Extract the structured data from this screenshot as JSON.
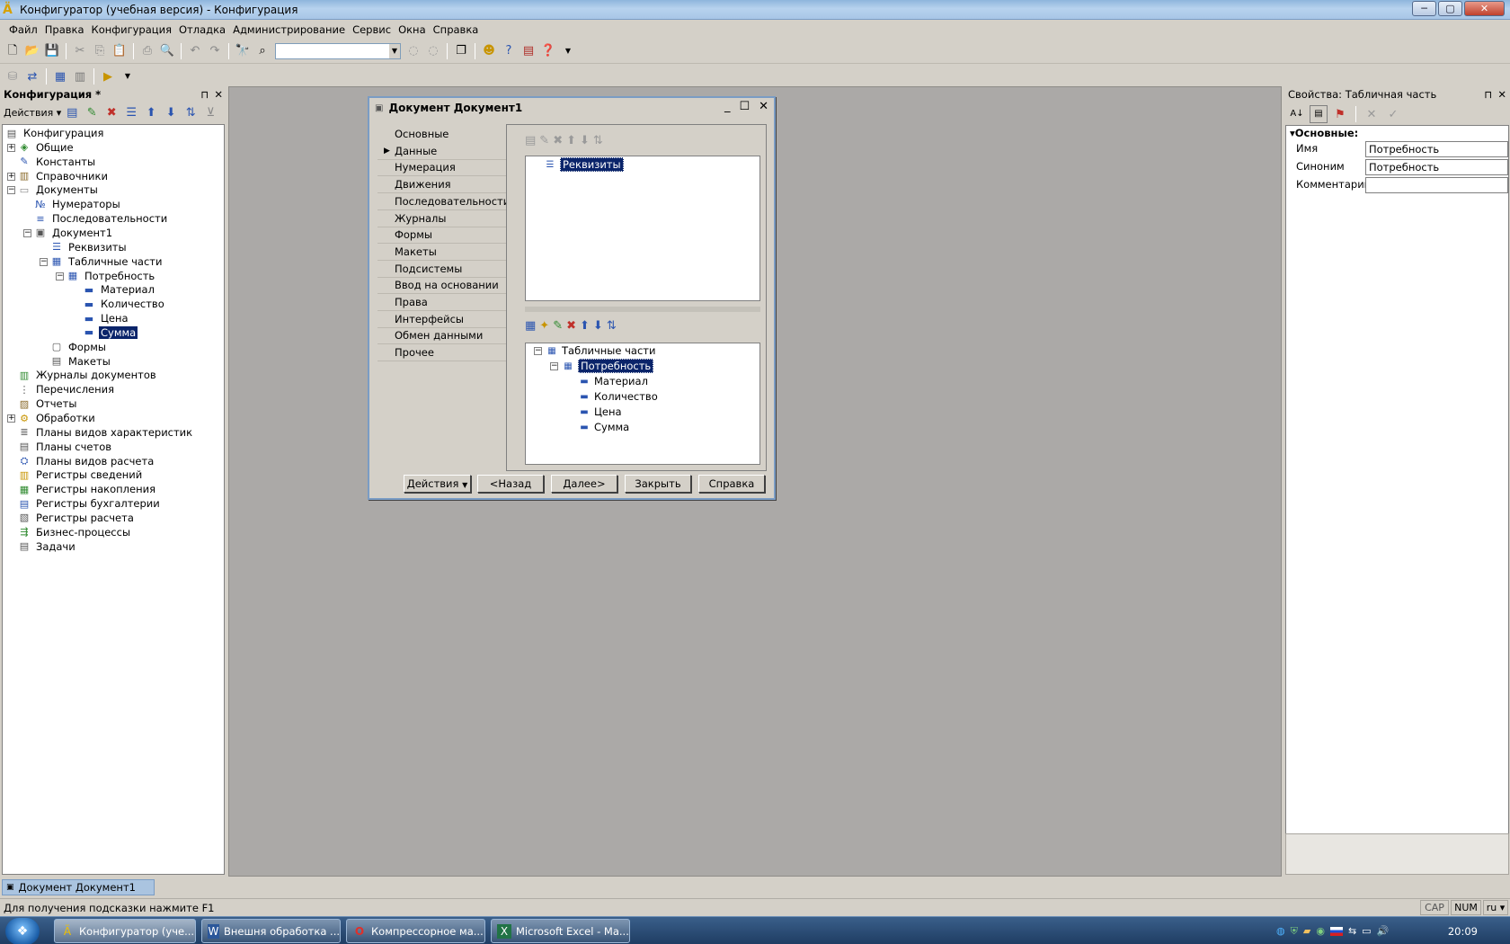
{
  "window": {
    "title": "Конфигуратор (учебная версия) - Конфигурация",
    "logo": "1C-logo-icon",
    "buttons": {
      "minimize": "─",
      "maximize": "▢",
      "close": "✕"
    }
  },
  "menu": [
    "Файл",
    "Правка",
    "Конфигурация",
    "Отладка",
    "Администрирование",
    "Сервис",
    "Окна",
    "Справка"
  ],
  "toolbar": {
    "search_value": ""
  },
  "left_panel": {
    "title": "Конфигурация *",
    "pin": "⊓",
    "close": "✕",
    "actions_label": "Действия",
    "tree": [
      {
        "label": "Конфигурация",
        "icon": "config-icon",
        "level": 0
      },
      {
        "label": "Общие",
        "icon": "common-icon",
        "level": 1,
        "expander": "+"
      },
      {
        "label": "Константы",
        "icon": "constants-icon",
        "level": 1
      },
      {
        "label": "Справочники",
        "icon": "catalogs-icon",
        "level": 1,
        "expander": "+"
      },
      {
        "label": "Документы",
        "icon": "documents-icon",
        "level": 1,
        "expander": "−"
      },
      {
        "label": "Нумераторы",
        "icon": "numerators-icon",
        "level": 2
      },
      {
        "label": "Последовательности",
        "icon": "sequences-icon",
        "level": 2
      },
      {
        "label": "Документ1",
        "icon": "document-icon",
        "level": 2,
        "expander": "−"
      },
      {
        "label": "Реквизиты",
        "icon": "attributes-icon",
        "level": 3
      },
      {
        "label": "Табличные части",
        "icon": "tabular-sections-icon",
        "level": 3,
        "expander": "−"
      },
      {
        "label": "Потребность",
        "icon": "tabular-section-icon",
        "level": 4,
        "expander": "−"
      },
      {
        "label": "Материал",
        "icon": "attribute-icon",
        "level": 5
      },
      {
        "label": "Количество",
        "icon": "attribute-icon",
        "level": 5
      },
      {
        "label": "Цена",
        "icon": "attribute-icon",
        "level": 5
      },
      {
        "label": "Сумма",
        "icon": "attribute-icon",
        "level": 5,
        "selected": true
      },
      {
        "label": "Формы",
        "icon": "forms-icon",
        "level": 3
      },
      {
        "label": "Макеты",
        "icon": "templates-icon",
        "level": 3
      },
      {
        "label": "Журналы документов",
        "icon": "journals-icon",
        "level": 1
      },
      {
        "label": "Перечисления",
        "icon": "enums-icon",
        "level": 1
      },
      {
        "label": "Отчеты",
        "icon": "reports-icon",
        "level": 1
      },
      {
        "label": "Обработки",
        "icon": "dataprocessors-icon",
        "level": 1,
        "expander": "+"
      },
      {
        "label": "Планы видов характеристик",
        "icon": "chart-of-characteristics-icon",
        "level": 1
      },
      {
        "label": "Планы счетов",
        "icon": "chart-of-accounts-icon",
        "level": 1
      },
      {
        "label": "Планы видов расчета",
        "icon": "chart-of-calc-icon",
        "level": 1
      },
      {
        "label": "Регистры сведений",
        "icon": "info-registers-icon",
        "level": 1
      },
      {
        "label": "Регистры накопления",
        "icon": "accum-registers-icon",
        "level": 1
      },
      {
        "label": "Регистры бухгалтерии",
        "icon": "acc-registers-icon",
        "level": 1
      },
      {
        "label": "Регистры расчета",
        "icon": "calc-registers-icon",
        "level": 1
      },
      {
        "label": "Бизнес-процессы",
        "icon": "business-processes-icon",
        "level": 1
      },
      {
        "label": "Задачи",
        "icon": "tasks-icon",
        "level": 1
      }
    ]
  },
  "dialog": {
    "title": "Документ Документ1",
    "controls": {
      "minimize": "_",
      "maximize": "☐",
      "close": "✕"
    },
    "nav": [
      "Основные",
      "Данные",
      "Нумерация",
      "Движения",
      "Последовательности",
      "Журналы",
      "Формы",
      "Макеты",
      "Подсистемы",
      "Ввод на основании",
      "Права",
      "Интерфейсы",
      "Обмен данными",
      "Прочее"
    ],
    "nav_active": "Данные",
    "attributes_box": {
      "item": "Реквизиты"
    },
    "tabular_box": {
      "root": "Табличные части",
      "section": "Потребность",
      "fields": [
        "Материал",
        "Количество",
        "Цена",
        "Сумма"
      ]
    },
    "buttons": {
      "actions": "Действия",
      "back": "<Назад",
      "next": "Далее>",
      "close": "Закрыть",
      "help": "Справка"
    }
  },
  "properties": {
    "title": "Свойства: Табличная часть",
    "pin": "⊓",
    "close": "✕",
    "group": "Основные:",
    "rows": [
      {
        "label": "Имя",
        "value": "Потребность"
      },
      {
        "label": "Синоним",
        "value": "Потребность"
      },
      {
        "label": "Комментарий",
        "value": ""
      }
    ]
  },
  "window_tabs": [
    {
      "label": "Документ Документ1",
      "active": true
    }
  ],
  "status": {
    "hint": "Для получения подсказки нажмите F1",
    "cap": "CAP",
    "num": "NUM",
    "lang": "ru"
  },
  "taskbar": {
    "items": [
      {
        "label": "Конфигуратор (уче...",
        "icon": "1c-icon",
        "active": true
      },
      {
        "label": "Внешня обработка ...",
        "icon": "word-icon"
      },
      {
        "label": "Компрессорное ма...",
        "icon": "opera-icon"
      },
      {
        "label": "Microsoft Excel - Ма...",
        "icon": "excel-icon"
      }
    ],
    "clock": "20:09",
    "tray_lang": "RU"
  },
  "colors": {
    "selection": "#0a246a",
    "workspace": "#aba9a7",
    "chrome": "#d4d0c8",
    "taskbar": "#1f3d63"
  }
}
